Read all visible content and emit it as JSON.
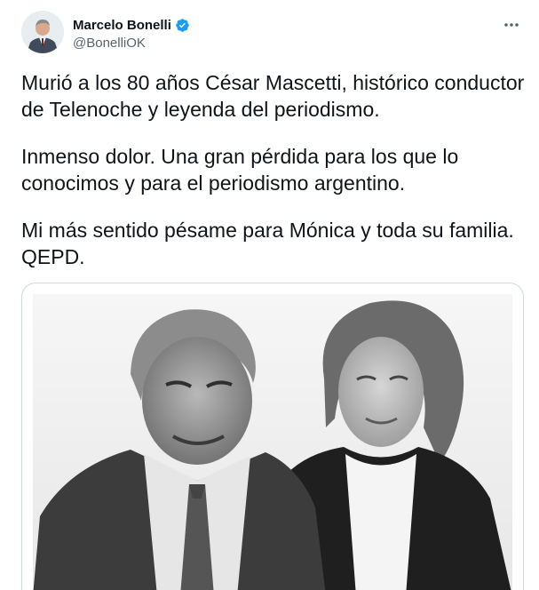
{
  "author": {
    "display_name": "Marcelo Bonelli",
    "handle": "@BonelliOK",
    "avatar_icon": "person-avatar",
    "verified_icon": "verified-badge-icon",
    "verified_color": "#1d9bf0"
  },
  "header": {
    "more_icon": "more-options-icon"
  },
  "tweet": {
    "paragraphs": [
      "Murió a los 80 años César Mascetti, histórico conductor de Telenoche y leyenda del periodismo.",
      "Inmenso dolor. Una gran pérdida para los que lo conocimos y para el periodismo argentino.",
      "Mi más sentido pésame para Mónica y toda su familia. QEPD."
    ]
  },
  "media": {
    "type": "photo",
    "style": "black-and-white portrait of a man and a woman"
  },
  "colors": {
    "text": "#0f1419",
    "secondary": "#536471",
    "border": "#cfd9de"
  }
}
